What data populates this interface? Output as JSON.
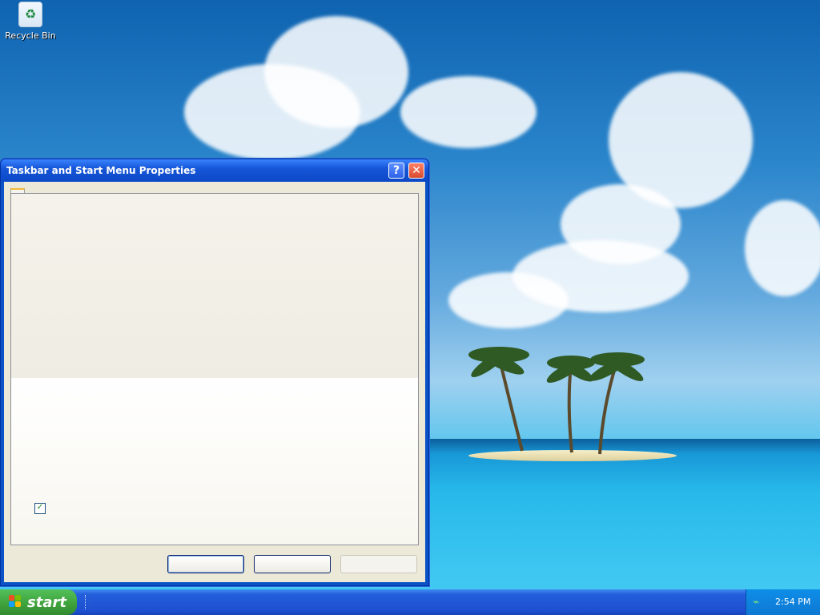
{
  "desktop": {
    "recycle_bin_label": "Recycle Bin"
  },
  "window": {
    "title": "Taskbar and Start Menu Properties",
    "help_label": "?",
    "close_label": "✕",
    "checkbox_checked": true
  },
  "taskbar": {
    "start_label": "start",
    "clock": "2:54 PM"
  },
  "icons": {
    "recycle_bin": "recycle-bin-icon",
    "help": "help-icon",
    "close": "close-icon",
    "windows_logo": "windows-logo-icon",
    "network": "network-icon"
  },
  "colors": {
    "window_frame": "#0A53C7",
    "start_button": "#3FA33D",
    "taskbar": "#1D4FD0"
  }
}
